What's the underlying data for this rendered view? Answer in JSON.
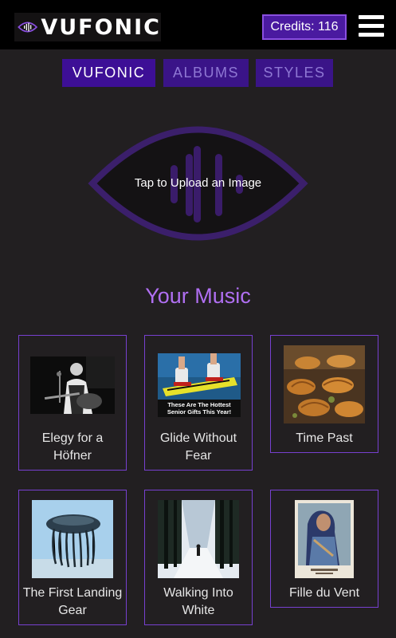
{
  "header": {
    "logo_text": "VUFONIC",
    "credits_label": "Credits: 116"
  },
  "nav": {
    "tabs": [
      {
        "label": "VUFONIC"
      },
      {
        "label": "ALBUMS"
      },
      {
        "label": "STYLES"
      }
    ]
  },
  "upload": {
    "label": "Tap to Upload an Image"
  },
  "music": {
    "section_title": "Your Music",
    "items": [
      {
        "title": "Elegy for a Höfner"
      },
      {
        "title": "Glide Without Fear",
        "ad_caption": "These Are The Hottest Senior Gifts This Year!"
      },
      {
        "title": "Time Past"
      },
      {
        "title": "The First Landing Gear"
      },
      {
        "title": "Walking Into White"
      },
      {
        "title": "Fille du Vent"
      }
    ]
  },
  "colors": {
    "background": "#221f21",
    "accent": "#7740d0",
    "tab_active": "#3d0f96",
    "title_purple": "#b06ff2"
  }
}
